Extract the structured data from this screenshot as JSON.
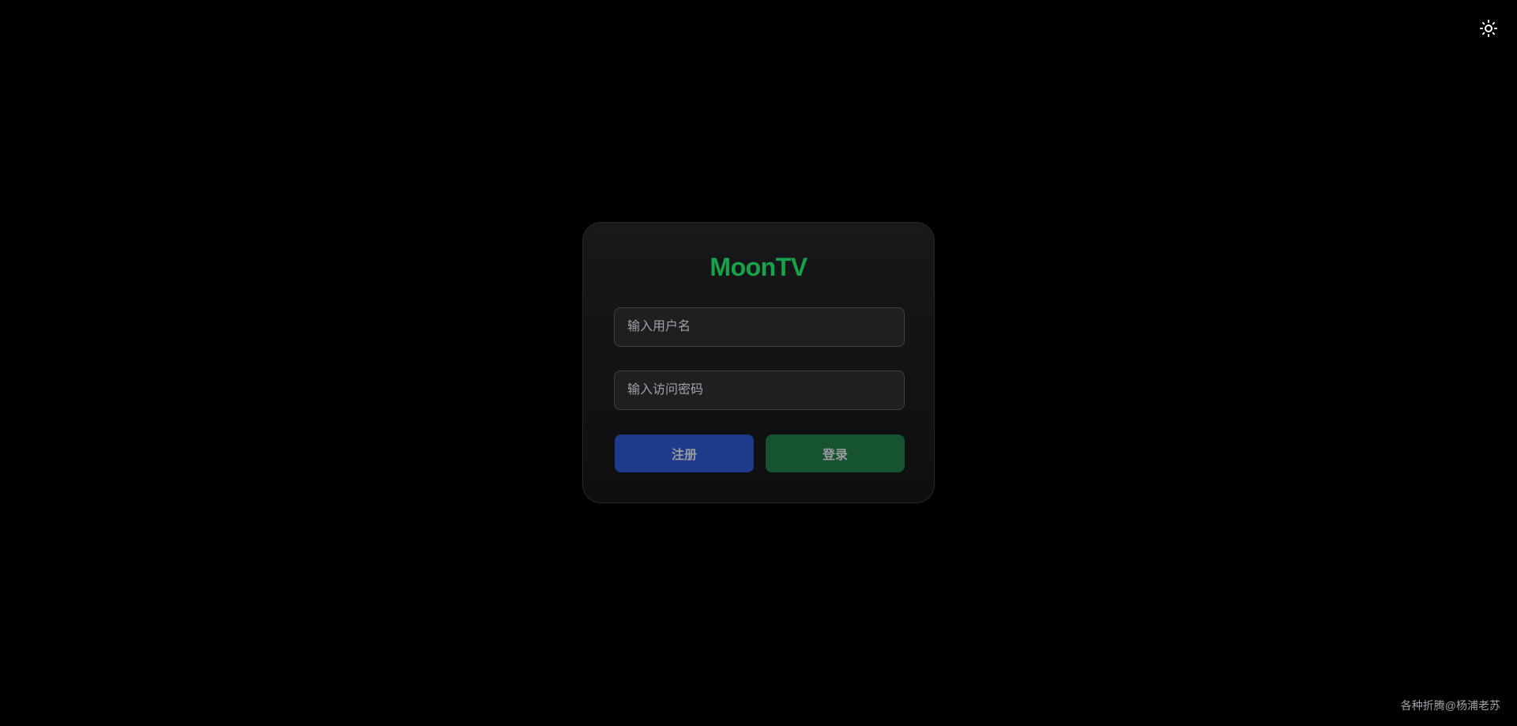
{
  "theme_toggle": {
    "icon": "sun-icon"
  },
  "login": {
    "title": "MoonTV",
    "username_placeholder": "输入用户名",
    "password_placeholder": "输入访问密码",
    "register_label": "注册",
    "login_label": "登录"
  },
  "footer": {
    "text": "各种折腾@杨浦老苏"
  },
  "colors": {
    "background": "#000000",
    "brand": "#16a34a",
    "register_button": "#1e3a8a",
    "login_button": "#14532d"
  }
}
